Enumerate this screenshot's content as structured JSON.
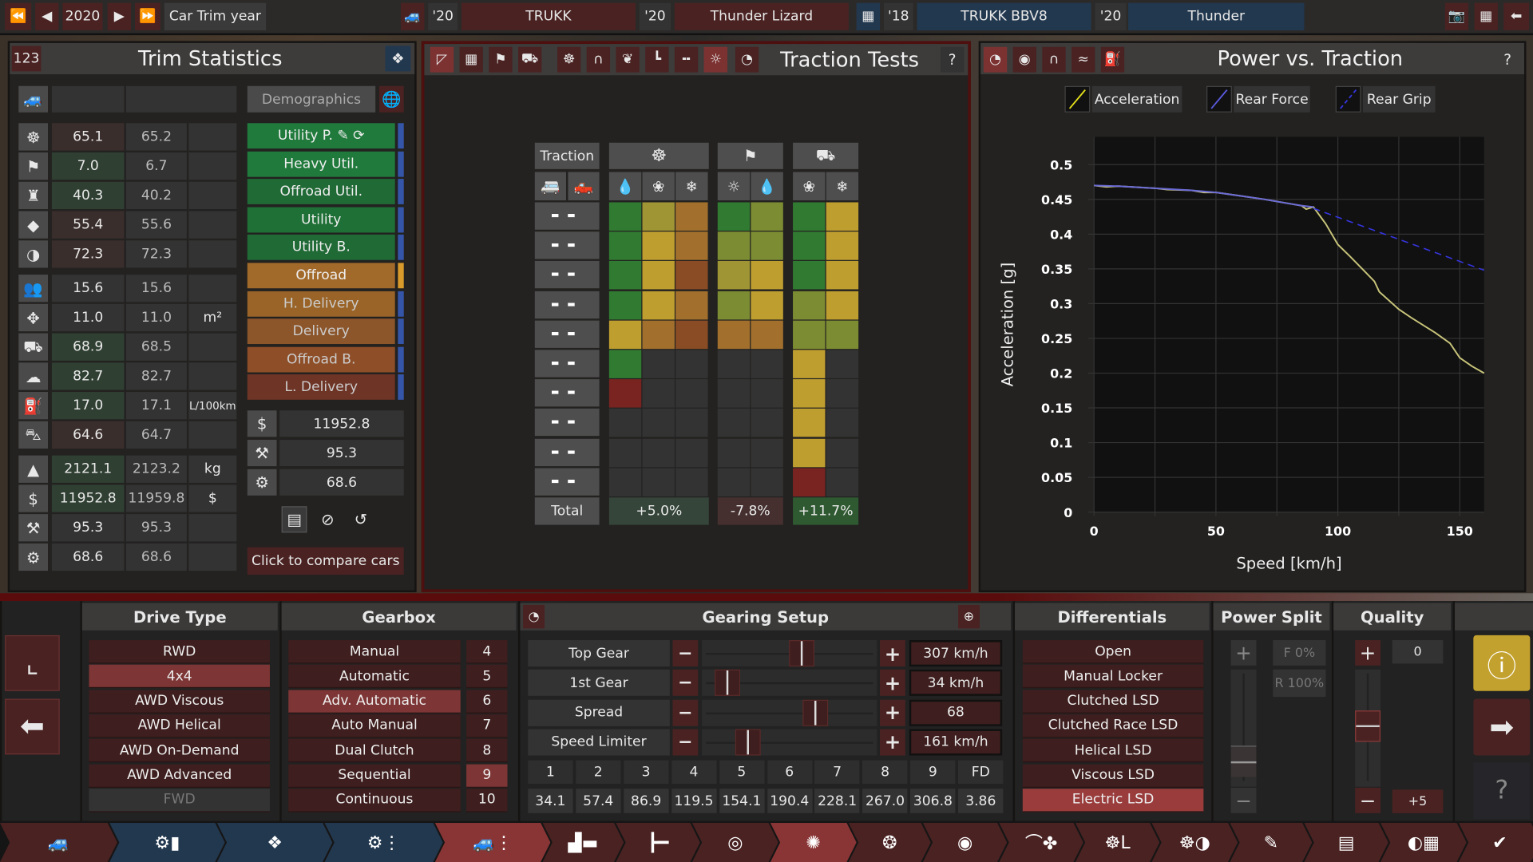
{
  "topbar": {
    "year": "2020",
    "year_label": "Car Trim year",
    "cars": [
      {
        "year": "'20",
        "name": "TRUKK"
      },
      {
        "year": "'20",
        "name": "Thunder Lizard"
      }
    ],
    "engines": [
      {
        "year": "'18",
        "name": "TRUKK BBV8"
      },
      {
        "year": "'20",
        "name": "Thunder"
      }
    ]
  },
  "trim": {
    "badge": "123",
    "title": "Trim Statistics",
    "demographics": "Demographics",
    "rows": [
      {
        "icon": "steering-wheel-icon",
        "glyph": "☸",
        "v1": "65.1",
        "v2": "65.2",
        "unit": "",
        "tone": "bad"
      },
      {
        "icon": "checkered-flag-icon",
        "glyph": "⚑",
        "v1": "7.0",
        "v2": "6.7",
        "unit": "",
        "tone": "good"
      },
      {
        "icon": "seat-icon",
        "glyph": "♜",
        "v1": "40.3",
        "v2": "40.2",
        "unit": "",
        "tone": "good"
      },
      {
        "icon": "diamond-icon",
        "glyph": "◆",
        "v1": "55.4",
        "v2": "55.6",
        "unit": "",
        "tone": "bad"
      },
      {
        "icon": "safety-icon",
        "glyph": "◑",
        "v1": "72.3",
        "v2": "72.3",
        "unit": "",
        "tone": "bad"
      },
      {
        "icon": "passengers-icon",
        "glyph": "👥",
        "v1": "15.6",
        "v2": "15.6",
        "unit": "",
        "tone": "neutral"
      },
      {
        "icon": "cargo-area-icon",
        "glyph": "✥",
        "v1": "11.0",
        "v2": "11.0",
        "unit": "m²",
        "tone": "neutral"
      },
      {
        "icon": "offroad-icon",
        "glyph": "⛟",
        "v1": "68.9",
        "v2": "68.5",
        "unit": "",
        "tone": "good"
      },
      {
        "icon": "environment-icon",
        "glyph": "☁",
        "v1": "82.7",
        "v2": "82.7",
        "unit": "",
        "tone": "good"
      },
      {
        "icon": "fuel-can-icon",
        "glyph": "⛽",
        "v1": "17.0",
        "v2": "17.1",
        "unit": "L/100km",
        "tone": "good"
      },
      {
        "icon": "towing-icon",
        "glyph": "⛍",
        "v1": "64.6",
        "v2": "64.7",
        "unit": "",
        "tone": "bad"
      },
      {
        "icon": "weight-icon",
        "glyph": "▲",
        "v1": "2121.1",
        "v2": "2123.2",
        "unit": "kg",
        "tone": "good"
      },
      {
        "icon": "cost-icon",
        "glyph": "$",
        "v1": "11952.8",
        "v2": "11959.8",
        "unit": "$",
        "tone": "good"
      },
      {
        "icon": "anvil-icon",
        "glyph": "⚒",
        "v1": "95.3",
        "v2": "95.3",
        "unit": "",
        "tone": "neutral"
      },
      {
        "icon": "service-gear-icon",
        "glyph": "⚙",
        "v1": "68.6",
        "v2": "68.6",
        "unit": "",
        "tone": "neutral"
      }
    ],
    "demographics_list": [
      {
        "label": "Utility P.",
        "color": "#1f7a3c",
        "side": "#3556a8"
      },
      {
        "label": "Heavy Util.",
        "color": "#1f7a3c",
        "side": "#3556a8"
      },
      {
        "label": "Offroad Util.",
        "color": "#206a36",
        "side": "#3556a8"
      },
      {
        "label": "Utility",
        "color": "#1f7036",
        "side": "#3556a8"
      },
      {
        "label": "Utility B.",
        "color": "#206a36",
        "side": "#3556a8"
      },
      {
        "label": "Offroad",
        "color": "#a26a2a",
        "side": "#d89a2a"
      },
      {
        "label": "H. Delivery",
        "color": "#9a6428",
        "side": "#3556a8"
      },
      {
        "label": "Delivery",
        "color": "#8c552a",
        "side": "#3556a8"
      },
      {
        "label": "Offroad B.",
        "color": "#8e4e28",
        "side": "#3556a8"
      },
      {
        "label": "L. Delivery",
        "color": "#6e3426",
        "side": "#3556a8"
      }
    ],
    "summary": [
      {
        "icon": "cost-icon",
        "glyph": "$",
        "value": "11952.8"
      },
      {
        "icon": "anvil-icon",
        "glyph": "⚒",
        "value": "95.3"
      },
      {
        "icon": "service-gear-icon",
        "glyph": "⚙",
        "value": "68.6"
      }
    ],
    "compare": "Click to compare cars"
  },
  "traction": {
    "title": "Traction Tests",
    "header": "Traction",
    "total_label": "Total",
    "totals": [
      {
        "value": "+5.0%",
        "tone": "#35453a"
      },
      {
        "value": "-7.8%",
        "tone": "#45302f"
      },
      {
        "value": "+11.7%",
        "tone": "#2f5a31"
      }
    ],
    "colors": {
      "G": "#317a31",
      "O": "#a2702c",
      "Y": "#bf9e30",
      "L": "#a09534",
      "V": "#7c8c32",
      "B": "#8a4c24",
      "R": "#7a2421",
      "-": "#333333"
    },
    "grid": [
      "GLO|GV|GY",
      "GYO|VV|GY",
      "GYB|LY|GY",
      "GYO|VY|VY",
      "YOB|OO|VV",
      "G--|--|Y-",
      "R--|--|Y-",
      "---|--|Y-",
      "---|--|Y-",
      "---|--|R-"
    ]
  },
  "power": {
    "title": "Power vs. Traction",
    "legend": [
      {
        "label": "Acceleration",
        "color": "#e5e01a",
        "dash": false
      },
      {
        "label": "Rear Force",
        "color": "#5a5ae0",
        "dash": false
      },
      {
        "label": "Rear Grip",
        "color": "#3535e0",
        "dash": true
      }
    ]
  },
  "chart_data": {
    "type": "line",
    "xlabel": "Speed [km/h]",
    "ylabel": "Acceleration [g]",
    "xlim": [
      0,
      160
    ],
    "ylim": [
      0,
      0.54
    ],
    "xticks": [
      0,
      50,
      100,
      150
    ],
    "yticks": [
      0,
      0.05,
      0.1,
      0.15,
      0.2,
      0.25,
      0.3,
      0.35,
      0.4,
      0.45,
      0.5
    ],
    "grid": true,
    "series": [
      {
        "name": "Acceleration",
        "color": "#c8c47a",
        "x": [
          0,
          5,
          10,
          20,
          25,
          30,
          40,
          45,
          50,
          60,
          70,
          80,
          85,
          87,
          90,
          95,
          100,
          105,
          110,
          115,
          117,
          125,
          130,
          140,
          146,
          150,
          155,
          160
        ],
        "y": [
          0.47,
          0.468,
          0.469,
          0.467,
          0.466,
          0.464,
          0.463,
          0.46,
          0.46,
          0.455,
          0.45,
          0.444,
          0.441,
          0.436,
          0.439,
          0.415,
          0.385,
          0.368,
          0.35,
          0.332,
          0.317,
          0.292,
          0.28,
          0.258,
          0.243,
          0.222,
          0.21,
          0.2
        ]
      },
      {
        "name": "Rear Force",
        "color": "#6b6bd8",
        "x": [
          0,
          10,
          25,
          40,
          50,
          60,
          70,
          80,
          85,
          90
        ],
        "y": [
          0.47,
          0.469,
          0.466,
          0.463,
          0.46,
          0.455,
          0.45,
          0.444,
          0.441,
          0.439
        ]
      },
      {
        "name": "Rear Grip",
        "color": "#3535e0",
        "dash": true,
        "x": [
          90,
          160
        ],
        "y": [
          0.437,
          0.348
        ]
      }
    ]
  },
  "drive": {
    "title": "Drive Type",
    "selected": 1,
    "items": [
      "RWD",
      "4x4",
      "AWD Viscous",
      "AWD Helical",
      "AWD On-Demand",
      "AWD Advanced",
      "FWD"
    ]
  },
  "gearbox": {
    "title": "Gearbox",
    "selected": 2,
    "items": [
      "Manual",
      "Automatic",
      "Adv. Automatic",
      "Auto Manual",
      "Dual Clutch",
      "Sequential",
      "Continuous"
    ],
    "gears": [
      "4",
      "5",
      "6",
      "7",
      "8",
      "9",
      "10"
    ],
    "gear_selected": 5
  },
  "gearing": {
    "title": "Gearing Setup",
    "rows": [
      {
        "label": "Top Gear",
        "value": "307 km/h",
        "pos": 0.57
      },
      {
        "label": "1st Gear",
        "value": "34 km/h",
        "pos": 0.145
      },
      {
        "label": "Spread",
        "value": "68",
        "pos": 0.65
      },
      {
        "label": "Speed Limiter",
        "value": "161 km/h",
        "pos": 0.26
      }
    ],
    "gear_numbers": [
      "1",
      "2",
      "3",
      "4",
      "5",
      "6",
      "7",
      "8",
      "9",
      "FD"
    ],
    "ratios": [
      "34.1",
      "57.4",
      "86.9",
      "119.5",
      "154.1",
      "190.4",
      "228.1",
      "267.0",
      "306.8",
      "3.86"
    ]
  },
  "diff": {
    "title": "Differentials",
    "selected": 6,
    "items": [
      "Open",
      "Manual Locker",
      "Clutched LSD",
      "Clutched Race LSD",
      "Helical LSD",
      "Viscous LSD",
      "Electric LSD"
    ]
  },
  "split": {
    "title": "Power Split",
    "front": "F 0%",
    "rear": "R 100%",
    "level": 0.08
  },
  "quality": {
    "title": "Quality",
    "value": "0",
    "cost": "+5",
    "level": 0.5
  },
  "nav": [
    {
      "icon": "car-body-icon",
      "g": "🚙",
      "s": "red"
    },
    {
      "icon": "engine-block-icon",
      "g": "⚙▮",
      "s": "blue"
    },
    {
      "icon": "engine-icon",
      "g": "❖",
      "s": "blue"
    },
    {
      "icon": "engine-tune-icon",
      "g": "⚙⋮",
      "s": "blue"
    },
    {
      "icon": "trim-icon",
      "g": "🚙⋮",
      "s": "hl"
    },
    {
      "icon": "chassis-icon",
      "g": "▟▬",
      "s": "red"
    },
    {
      "icon": "drivetrain-icon",
      "g": "┣━",
      "s": "red"
    },
    {
      "icon": "lights-icon",
      "g": "◎",
      "s": "red"
    },
    {
      "icon": "gearing-icon",
      "g": "✺",
      "s": "hl"
    },
    {
      "icon": "wheels-icon",
      "g": "❂",
      "s": "red"
    },
    {
      "icon": "brakes-icon",
      "g": "◉",
      "s": "red"
    },
    {
      "icon": "aero-icon",
      "g": "⌒✤",
      "s": "red"
    },
    {
      "icon": "interior-icon",
      "g": "☸L",
      "s": "red"
    },
    {
      "icon": "safety-icon",
      "g": "☸◑",
      "s": "red"
    },
    {
      "icon": "paint-icon",
      "g": "✎",
      "s": "red"
    },
    {
      "icon": "summary-icon",
      "g": "▤",
      "s": "red"
    },
    {
      "icon": "testing-icon",
      "g": "◐▦",
      "s": "red"
    },
    {
      "icon": "finish-check-icon",
      "g": "✔",
      "s": "red"
    }
  ]
}
